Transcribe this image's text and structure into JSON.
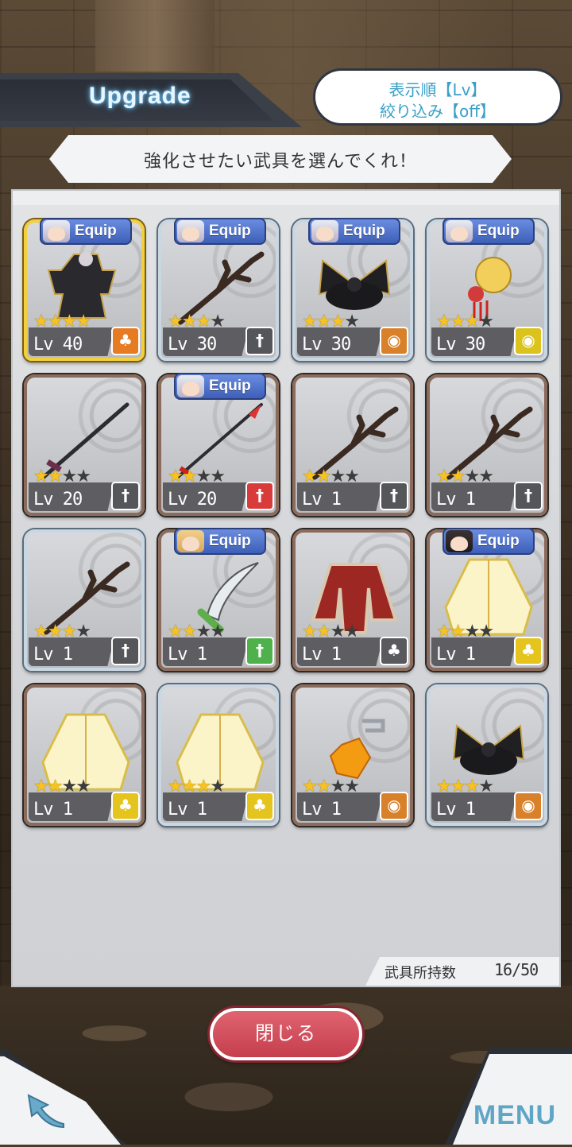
{
  "header": {
    "title": "Upgrade",
    "sort_label": "表示順【Lv】",
    "filter_label": "絞り込み【off】"
  },
  "instruction": "強化させたい武具を選んでくれ！",
  "items": [
    {
      "equip": "Equip",
      "stars": 4,
      "max_stars": 4,
      "level": "Lv 40",
      "type_icon": "armor-icon",
      "art": "dark-armor",
      "face": "silver"
    },
    {
      "equip": "Equip",
      "stars": 3,
      "max_stars": 4,
      "level": "Lv 30",
      "type_icon": "sword-icon",
      "art": "branch-staff",
      "face": "silver"
    },
    {
      "equip": "Equip",
      "stars": 3,
      "max_stars": 4,
      "level": "Lv 30",
      "type_icon": "accessory-icon",
      "art": "black-ribbon",
      "face": "silver"
    },
    {
      "equip": "Equip",
      "stars": 3,
      "max_stars": 4,
      "level": "Lv 30",
      "type_icon": "accessory-icon",
      "art": "flower-hairpin",
      "face": "silver"
    },
    {
      "equip": "",
      "stars": 2,
      "max_stars": 4,
      "level": "Lv 20",
      "type_icon": "sword-icon",
      "art": "spear",
      "face": ""
    },
    {
      "equip": "Equip",
      "stars": 2,
      "max_stars": 4,
      "level": "Lv 20",
      "type_icon": "sword-icon",
      "art": "red-spear",
      "face": "silver"
    },
    {
      "equip": "",
      "stars": 2,
      "max_stars": 4,
      "level": "Lv 1",
      "type_icon": "sword-icon",
      "art": "branch-staff",
      "face": ""
    },
    {
      "equip": "",
      "stars": 2,
      "max_stars": 4,
      "level": "Lv 1",
      "type_icon": "sword-icon",
      "art": "branch-staff",
      "face": ""
    },
    {
      "equip": "",
      "stars": 3,
      "max_stars": 4,
      "level": "Lv 1",
      "type_icon": "sword-icon",
      "art": "branch-staff",
      "face": ""
    },
    {
      "equip": "Equip",
      "stars": 2,
      "max_stars": 4,
      "level": "Lv 1",
      "type_icon": "sword-icon",
      "art": "curved-blade",
      "face": "blonde"
    },
    {
      "equip": "",
      "stars": 2,
      "max_stars": 4,
      "level": "Lv 1",
      "type_icon": "armor-icon",
      "art": "red-coat",
      "face": ""
    },
    {
      "equip": "Equip",
      "stars": 2,
      "max_stars": 4,
      "level": "Lv 1",
      "type_icon": "armor-icon",
      "art": "white-kimono",
      "face": "dark"
    },
    {
      "equip": "",
      "stars": 2,
      "max_stars": 4,
      "level": "Lv 1",
      "type_icon": "armor-icon",
      "art": "white-kimono",
      "face": ""
    },
    {
      "equip": "",
      "stars": 3,
      "max_stars": 4,
      "level": "Lv 1",
      "type_icon": "armor-icon",
      "art": "white-kimono",
      "face": ""
    },
    {
      "equip": "",
      "stars": 2,
      "max_stars": 4,
      "level": "Lv 1",
      "type_icon": "accessory-icon",
      "art": "amber-earring",
      "face": ""
    },
    {
      "equip": "",
      "stars": 3,
      "max_stars": 4,
      "level": "Lv 1",
      "type_icon": "accessory-icon",
      "art": "black-ribbon",
      "face": ""
    }
  ],
  "inventory": {
    "label": "武具所持数",
    "count": "16/50"
  },
  "close_button": "閉じる",
  "nav": {
    "menu_label": "MENU"
  },
  "colors": {
    "accent_blue": "#5fa6c6",
    "close_red": "#d24b59",
    "star_gold": "#f7c321"
  }
}
